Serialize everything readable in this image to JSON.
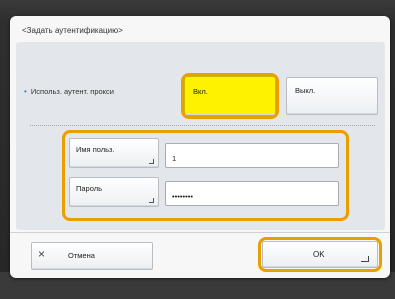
{
  "dialog": {
    "title": "<Задать аутентификацию>"
  },
  "proxy_auth": {
    "label": "Использ. аутент. прокси",
    "on_label": "Вкл.",
    "off_label": "Выкл.",
    "selected": "Вкл."
  },
  "credentials": {
    "user_button_label": "Имя польз.",
    "user_value": "1",
    "password_button_label": "Пароль",
    "password_value": "••••••••"
  },
  "footer": {
    "cancel_label": "Отмена",
    "ok_label": "OK"
  },
  "colors": {
    "highlight": "#e8a000",
    "selected_button": "#fff200",
    "bullet": "#3c7bd8"
  },
  "icons": {
    "cancel": "close-icon",
    "ok": "enter-icon",
    "field_corner": "corner-arrow-icon"
  }
}
